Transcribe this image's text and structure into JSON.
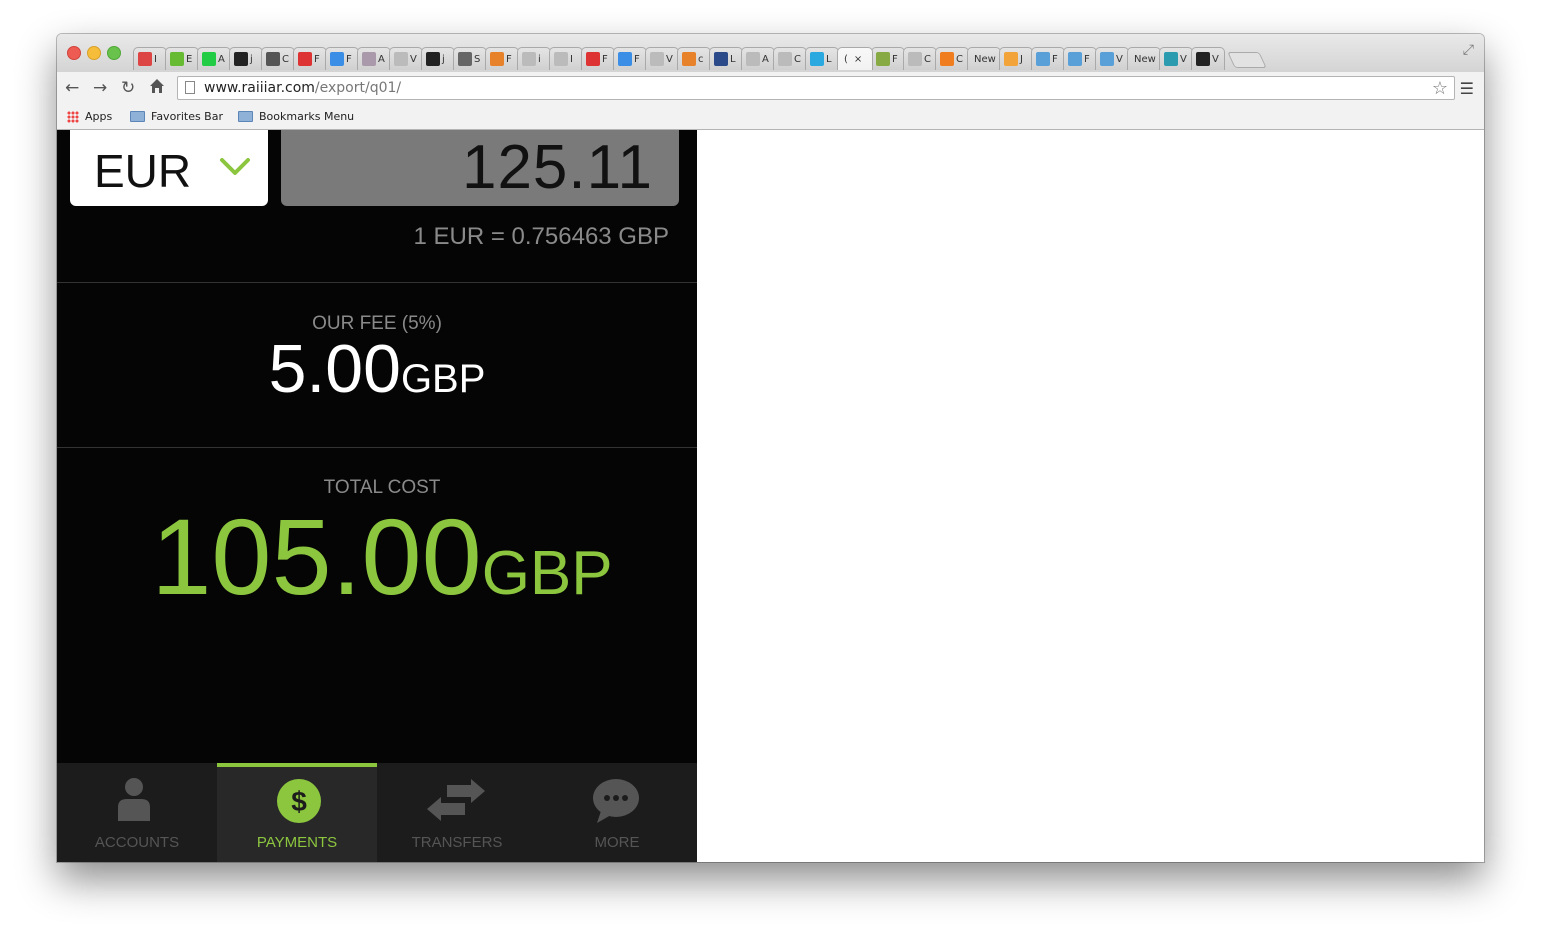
{
  "browser": {
    "tabs": [
      {
        "title": "I",
        "icon": "gmail-icon",
        "color": "#d44"
      },
      {
        "title": "E",
        "icon": "check-icon",
        "color": "#6b3"
      },
      {
        "title": "A",
        "icon": "app-icon",
        "color": "#2c4"
      },
      {
        "title": "j",
        "icon": "github-icon",
        "color": "#222"
      },
      {
        "title": "C",
        "icon": "circle-icon",
        "color": "#555"
      },
      {
        "title": "F",
        "icon": "stack-icon",
        "color": "#d33"
      },
      {
        "title": "F",
        "icon": "f-icon",
        "color": "#3a8ee6"
      },
      {
        "title": "A",
        "icon": "mountain-icon",
        "color": "#a9a"
      },
      {
        "title": "V",
        "icon": "doc-icon",
        "color": "#bbb"
      },
      {
        "title": "j",
        "icon": "github-icon",
        "color": "#222"
      },
      {
        "title": "S",
        "icon": "face-icon",
        "color": "#666"
      },
      {
        "title": "F",
        "icon": "stackoverflow-icon",
        "color": "#e8822a"
      },
      {
        "title": "i",
        "icon": "doc-icon",
        "color": "#bbb"
      },
      {
        "title": "I",
        "icon": "doc-icon",
        "color": "#bbb"
      },
      {
        "title": "F",
        "icon": "stack-icon",
        "color": "#d33"
      },
      {
        "title": "F",
        "icon": "f-icon",
        "color": "#3a8ee6"
      },
      {
        "title": "V",
        "icon": "doc-icon",
        "color": "#bbb"
      },
      {
        "title": "c",
        "icon": "stackoverflow-icon",
        "color": "#e8822a"
      },
      {
        "title": "L",
        "icon": "back-icon",
        "color": "#2a4a8a"
      },
      {
        "title": "A",
        "icon": "doc-icon",
        "color": "#bbb"
      },
      {
        "title": "C",
        "icon": "doc-icon",
        "color": "#bbb"
      },
      {
        "title": "L",
        "icon": "phone-icon",
        "color": "#29a9e0"
      },
      {
        "title": "(",
        "icon": "none",
        "color": "#f5f5f5",
        "active": true
      },
      {
        "title": "F",
        "icon": "m-icon",
        "color": "#8a4"
      },
      {
        "title": "C",
        "icon": "doc-icon",
        "color": "#bbb"
      },
      {
        "title": "C",
        "icon": "b-icon",
        "color": "#f07d20"
      },
      {
        "title": "New",
        "icon": "none",
        "color": "#e0e0e0"
      },
      {
        "title": "J",
        "icon": "ad-icon",
        "color": "#f2a33a"
      },
      {
        "title": "F",
        "icon": "info-icon",
        "color": "#5aa0d8"
      },
      {
        "title": "F",
        "icon": "info-icon",
        "color": "#5aa0d8"
      },
      {
        "title": "V",
        "icon": "info-icon",
        "color": "#5aa0d8"
      },
      {
        "title": "New",
        "icon": "none",
        "color": "#e0e0e0"
      },
      {
        "title": "V",
        "icon": "power-icon",
        "color": "#2b9bb0"
      },
      {
        "title": "V",
        "icon": "dark-icon",
        "color": "#222"
      }
    ],
    "url_host": "www.raiiiar.com",
    "url_path": "/export/q01/",
    "bookmarks": {
      "apps": "Apps",
      "favorites": "Favorites Bar",
      "menu": "Bookmarks Menu"
    }
  },
  "converter": {
    "currency": "EUR",
    "amount": "125.11",
    "rate": "1 EUR = 0.756463 GBP"
  },
  "fee": {
    "label": "OUR FEE (5%)",
    "amount": "5.00",
    "currency": "GBP"
  },
  "total": {
    "label": "TOTAL COST",
    "amount": "105.00",
    "currency": "GBP"
  },
  "nav": {
    "accounts": "ACCOUNTS",
    "payments": "PAYMENTS",
    "transfers": "TRANSFERS",
    "more": "MORE"
  },
  "colors": {
    "accent": "#8cc63f",
    "app_background": "#050505",
    "nav_background": "#1c1c1c"
  }
}
